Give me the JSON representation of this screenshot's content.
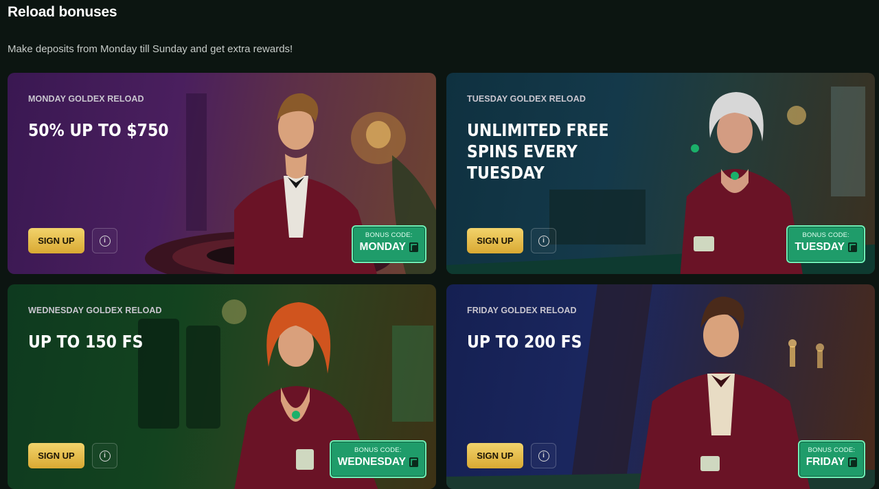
{
  "page": {
    "title": "Reload bonuses",
    "subtitle": "Make deposits from Monday till Sunday and get extra rewards!"
  },
  "cards": [
    {
      "label": "MONDAY GOLDEX RELOAD",
      "headline": "50% UP TO $750",
      "signup": "SIGN UP",
      "bonus_code_label": "BONUS CODE:",
      "bonus_code": "MONDAY"
    },
    {
      "label": "TUESDAY GOLDEX RELOAD",
      "headline": "UNLIMITED FREE SPINS EVERY TUESDAY",
      "signup": "SIGN UP",
      "bonus_code_label": "BONUS CODE:",
      "bonus_code": "TUESDAY"
    },
    {
      "label": "WEDNESDAY GOLDEX RELOAD",
      "headline": "UP TO 150 FS",
      "signup": "SIGN UP",
      "bonus_code_label": "BONUS CODE:",
      "bonus_code": "WEDNESDAY"
    },
    {
      "label": "FRIDAY GOLDEX RELOAD",
      "headline": "UP TO 200 FS",
      "signup": "SIGN UP",
      "bonus_code_label": "BONUS CODE:",
      "bonus_code": "FRIDAY"
    }
  ],
  "colors": {
    "background": "#0c1511",
    "signup_button": "#e6bd4d",
    "bonus_code_bg": "#1f9c6a",
    "bonus_code_border": "#6ef0b6"
  }
}
